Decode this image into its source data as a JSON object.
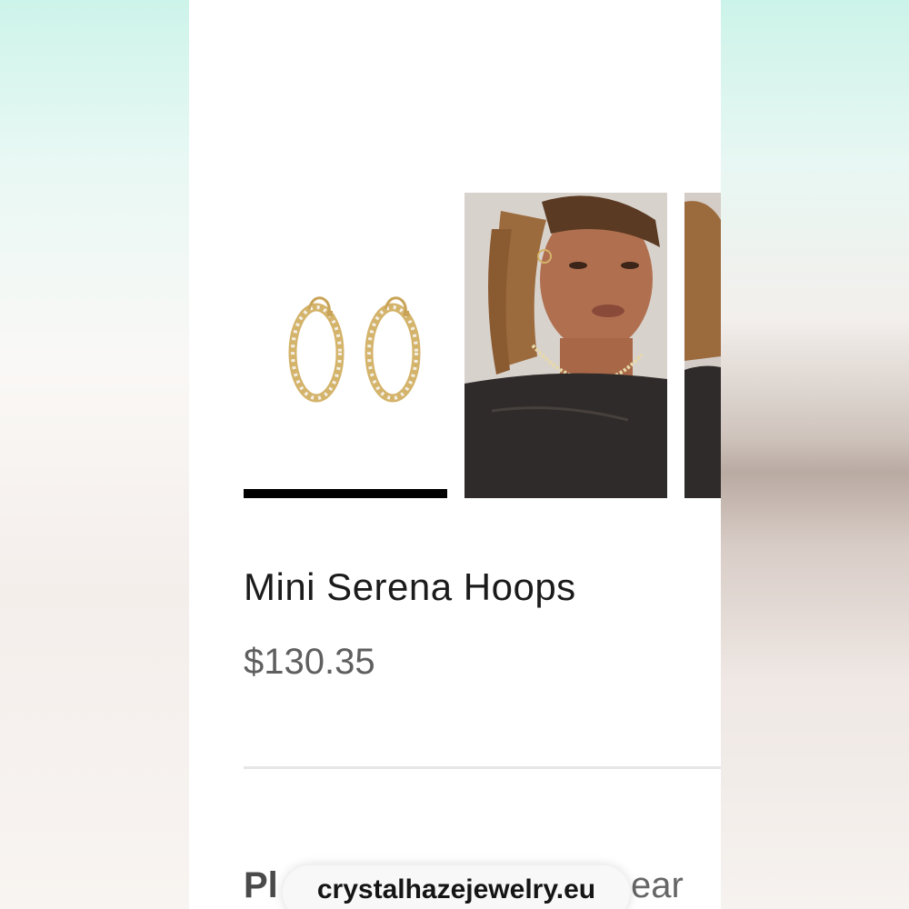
{
  "product": {
    "title": "Mini Serena Hoops",
    "price": "$130.35"
  },
  "gallery": {
    "images": [
      {
        "name": "product-image-earrings",
        "active": true
      },
      {
        "name": "model-photo-necklace",
        "active": false
      },
      {
        "name": "model-photo-partial",
        "active": false
      }
    ]
  },
  "partial_section": {
    "left_text": "Pl",
    "right_text": "ear"
  },
  "browser": {
    "url": "crystalhazejewelry.eu"
  },
  "colors": {
    "active_indicator": "#000000",
    "price": "#5f5f5f",
    "title": "#1b1b1b"
  }
}
